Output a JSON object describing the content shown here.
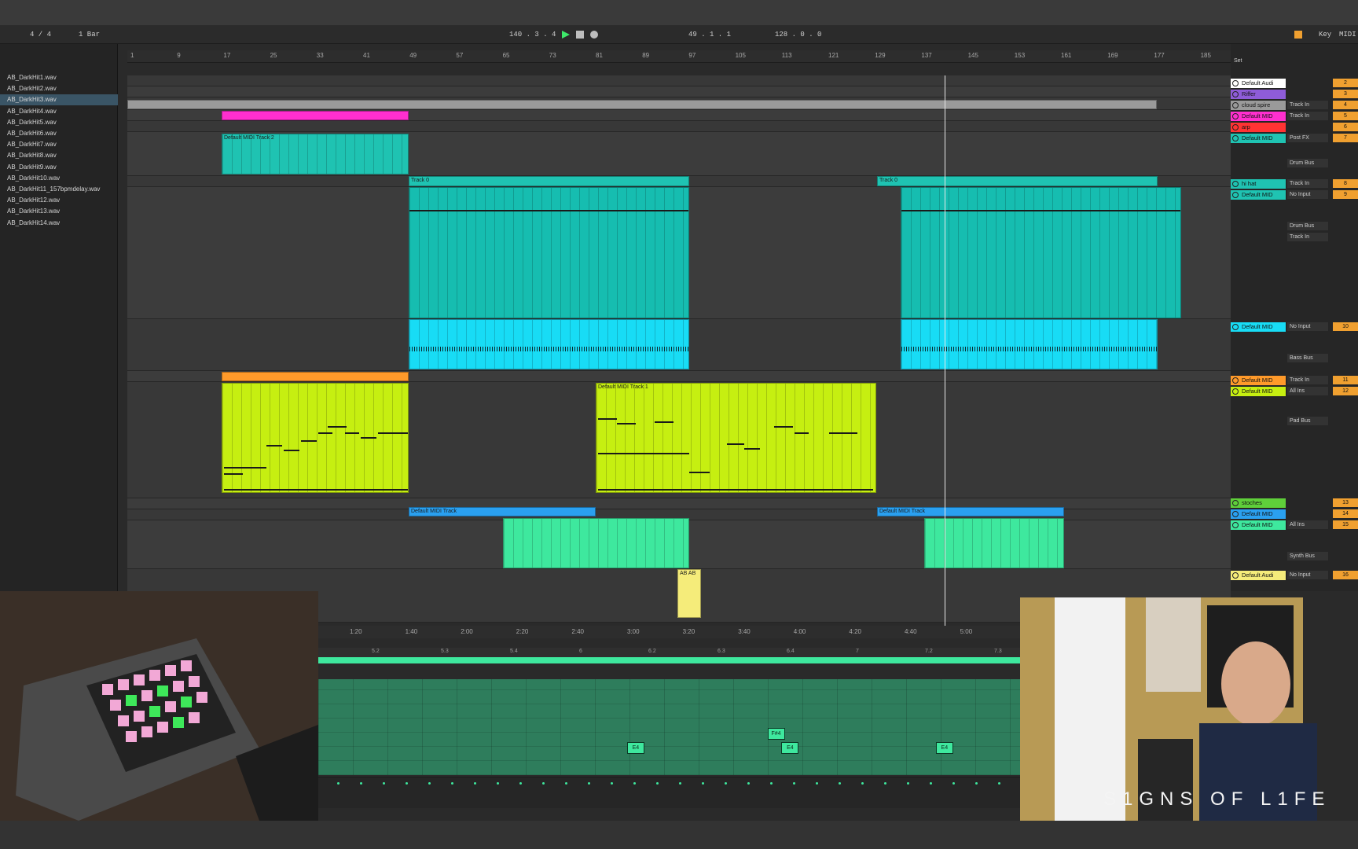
{
  "transport": {
    "time_sig": "4 / 4",
    "quantize": "1 Bar",
    "tempo": "140 . 3 . 4",
    "position": "49 . 1 . 1",
    "zoom": "128 . 0 . 0",
    "key_label": "Key",
    "midi_label": "MIDI"
  },
  "browser": {
    "files": [
      "AB_DarkHit1.wav",
      "AB_DarkHit2.wav",
      "AB_DarkHit3.wav",
      "AB_DarkHit4.wav",
      "AB_DarkHit5.wav",
      "AB_DarkHit6.wav",
      "AB_DarkHit7.wav",
      "AB_DarkHit8.wav",
      "AB_DarkHit9.wav",
      "AB_DarkHit10.wav",
      "AB_DarkHit11_157bpmdelay.wav",
      "AB_DarkHit12.wav",
      "AB_DarkHit13.wav",
      "AB_DarkHit14.wav"
    ],
    "selected_index": 2
  },
  "ruler": [
    "1",
    "9",
    "17",
    "25",
    "33",
    "41",
    "49",
    "57",
    "65",
    "73",
    "81",
    "89",
    "97",
    "105",
    "113",
    "121",
    "129",
    "137",
    "145",
    "153",
    "161",
    "169",
    "177",
    "185"
  ],
  "clips": {
    "track2_name": "Default MIDI Track 2",
    "track0_a": "Track 0",
    "track0_b": "Track 0",
    "track1_name": "Default MIDI Track 1",
    "midi_a": "Default MIDI Track",
    "midi_b": "Default MIDI Track",
    "small": "AB AB"
  },
  "mixer": {
    "set_label": "Set",
    "tracks": [
      {
        "name": "Default Audi",
        "color": "#ffffff",
        "io": "",
        "num": "2"
      },
      {
        "name": "Riffer",
        "color": "#8e5cd8",
        "io": "",
        "num": "3"
      },
      {
        "name": "cloud spire",
        "color": "#9a9a9a",
        "io": "Track In",
        "num": "4"
      },
      {
        "name": "Default MID",
        "color": "#ff2fcf",
        "io": "Track In",
        "num": "5"
      },
      {
        "name": "arp",
        "color": "#ff3333",
        "io": "",
        "num": "6"
      },
      {
        "name": "Default MID",
        "color": "#1fc3b2",
        "io": "Post FX",
        "num": "7"
      },
      {
        "name": "hi hat",
        "color": "#1fc3b2",
        "io": "Track In",
        "num": "8"
      },
      {
        "name": "Default MID",
        "color": "#1fc3b2",
        "io": "No Input",
        "num": "9"
      },
      {
        "name": "Default MID",
        "color": "#18dcf5",
        "io": "No Input",
        "num": "10"
      },
      {
        "name": "Default MID",
        "color": "#ff9a2a",
        "io": "Track In",
        "num": "11"
      },
      {
        "name": "Default MID",
        "color": "#c6ef11",
        "io": "All Ins",
        "num": "12"
      },
      {
        "name": "stoches",
        "color": "#5fcf3a",
        "io": "",
        "num": "13"
      },
      {
        "name": "Default MID",
        "color": "#2aa0f0",
        "io": "",
        "num": "14"
      },
      {
        "name": "Default MID",
        "color": "#3ee89e",
        "io": "All Ins",
        "num": "15"
      },
      {
        "name": "Default Audi",
        "color": "#f5ec7a",
        "io": "No Input",
        "num": "16"
      }
    ],
    "bus_labels": {
      "drum1": "Drum Bus",
      "drum2": "Drum Bus",
      "bass": "Bass Bus",
      "pad": "Pad Bus",
      "synth": "Synth Bus",
      "trackin": "Track In"
    }
  },
  "timeline2": [
    "1:20",
    "1:40",
    "2:00",
    "2:20",
    "2:40",
    "3:00",
    "3:20",
    "3:40",
    "4:00",
    "4:20",
    "4:40",
    "5:00"
  ],
  "clipview_ruler": [
    "5.2",
    "5.3",
    "5.4",
    "6",
    "6.2",
    "6.3",
    "6.4",
    "7",
    "7.2",
    "7.3"
  ],
  "notes": [
    {
      "label": "E4",
      "pos": 0.44,
      "row": 1
    },
    {
      "label": "F#4",
      "pos": 0.64,
      "row": 0
    },
    {
      "label": "E4",
      "pos": 0.66,
      "row": 1
    },
    {
      "label": "E4",
      "pos": 0.88,
      "row": 1
    }
  ],
  "brand": "S1GNS OF L1FE"
}
